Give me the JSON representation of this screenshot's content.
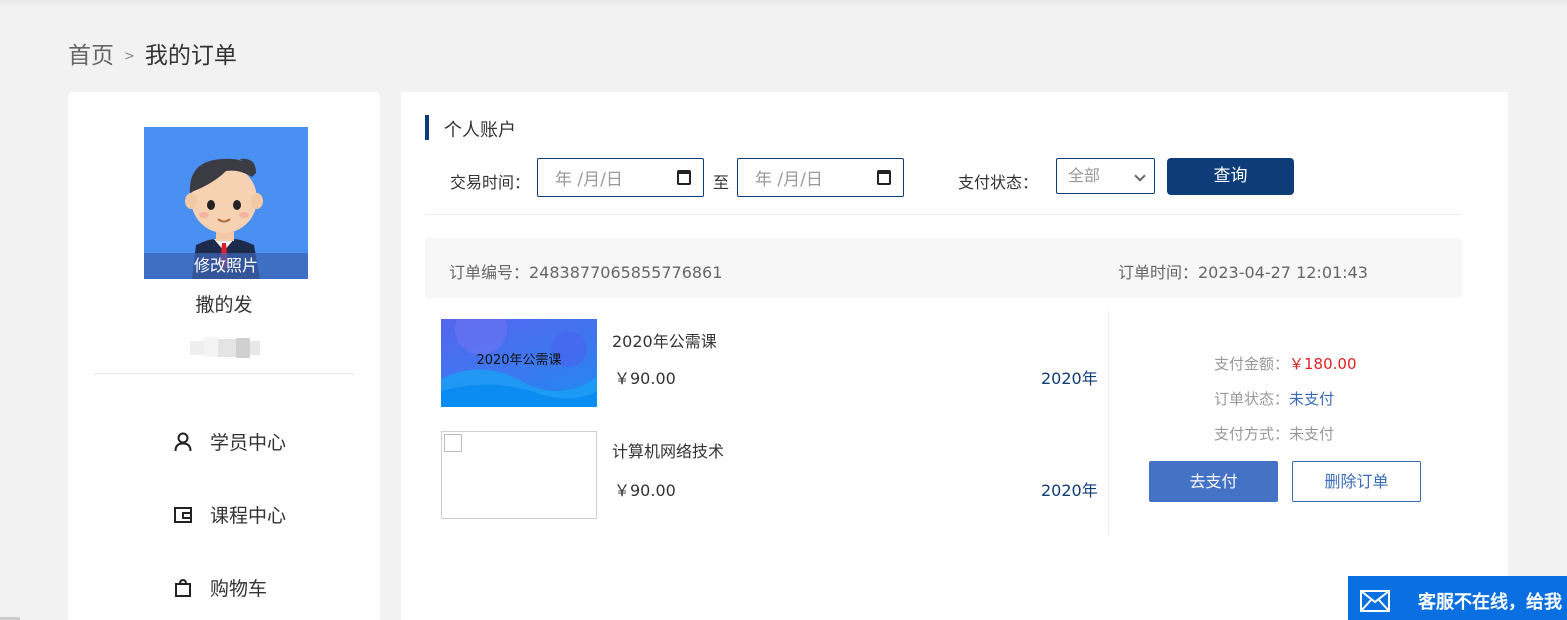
{
  "breadcrumb": {
    "home": "首页",
    "separator": ">",
    "current": "我的订单"
  },
  "sidebar": {
    "avatar_label": "修改照片",
    "user_name": "撒的发",
    "items": [
      {
        "label": "学员中心",
        "icon": "user-icon"
      },
      {
        "label": "课程中心",
        "icon": "wallet-icon"
      },
      {
        "label": "购物车",
        "icon": "shopping-bag-icon"
      }
    ]
  },
  "account": {
    "title": "个人账户",
    "filters": {
      "time_label": "交易时间：",
      "date_start_placeholder": "年 /月/日",
      "to_label": "至",
      "date_end_placeholder": "年 /月/日",
      "status_label": "支付状态：",
      "status_value": "全部",
      "query_button": "查询"
    }
  },
  "order": {
    "number_label": "订单编号：2483877065855776861",
    "time_label": "订单时间：2023-04-27 12:01:43",
    "items": [
      {
        "name": "2020年公需课",
        "price": "￥90.00",
        "year": "2020年",
        "thumb_text": "2020年公需课"
      },
      {
        "name": "计算机网络技术",
        "price": "￥90.00",
        "year": "2020年",
        "thumb_text": ""
      }
    ],
    "payment": {
      "amount_label": "支付金额：",
      "amount_value": "￥180.00",
      "status_label": "订单状态：",
      "status_value": "未支付",
      "method_label": "支付方式：",
      "method_value": "未支付"
    },
    "pay_button": "去支付",
    "delete_button": "删除订单"
  },
  "service": {
    "text": "客服不在线，给我"
  },
  "colors": {
    "primary": "#0d3c78",
    "button_blue": "#4472c4",
    "price_red": "#e02020",
    "service_blue": "#0a6fe0"
  }
}
